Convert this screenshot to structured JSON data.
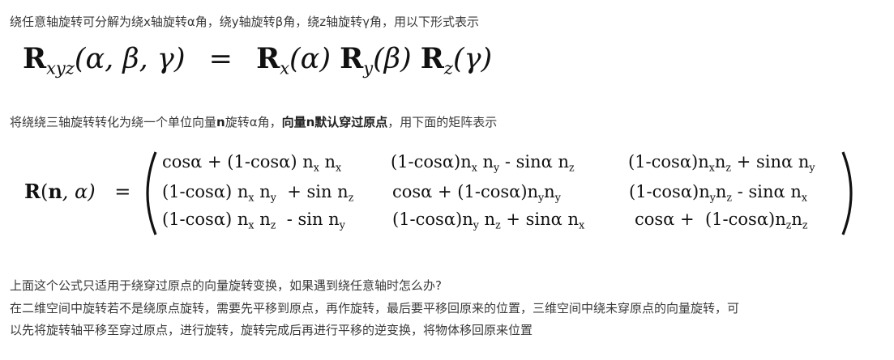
{
  "paragraphs": {
    "p1": "绕任意轴旋转可分解为绕x轴旋转α角，绕y轴旋转β角，绕z轴旋转γ角，用以下形式表示",
    "p2_a": "将绕绕三轴旋转转化为绕一个单位向量",
    "p2_n": "n",
    "p2_b": "旋转α角，",
    "p2_bold": "向量n默认穿过原点",
    "p2_c": "，用下面的矩阵表示",
    "p3": "上面这个公式只适用于绕穿过原点的向量旋转变换，如果遇到绕任意轴时怎么办?",
    "p4_line1": "在二维空间中旋转若不是绕原点旋转，需要先平移到原点，再作旋转，最后要平移回原来的位置，三维空间中绕未穿原点的向量旋转，可",
    "p4_line2": "以先将旋转轴平移至穿过原点，进行旋转，旋转完成后再进行平移的逆变换，将物体移回原来位置"
  },
  "formula1": {
    "lhs_R": "R",
    "lhs_sub": "xyz",
    "lhs_args": "(α, β, γ)",
    "eq": "=",
    "rx_R": "R",
    "rx_sub": "x",
    "rx_arg": "(α)",
    "ry_R": "R",
    "ry_sub": "y",
    "ry_arg": "(β)",
    "rz_R": "R",
    "rz_sub": "z",
    "rz_arg": "(γ)"
  },
  "formula2": {
    "lhs": "R(n, α)",
    "lhs_R": "R",
    "lhs_open": "(",
    "lhs_n": "n",
    "lhs_rest": ", α)",
    "eq": "="
  }
}
